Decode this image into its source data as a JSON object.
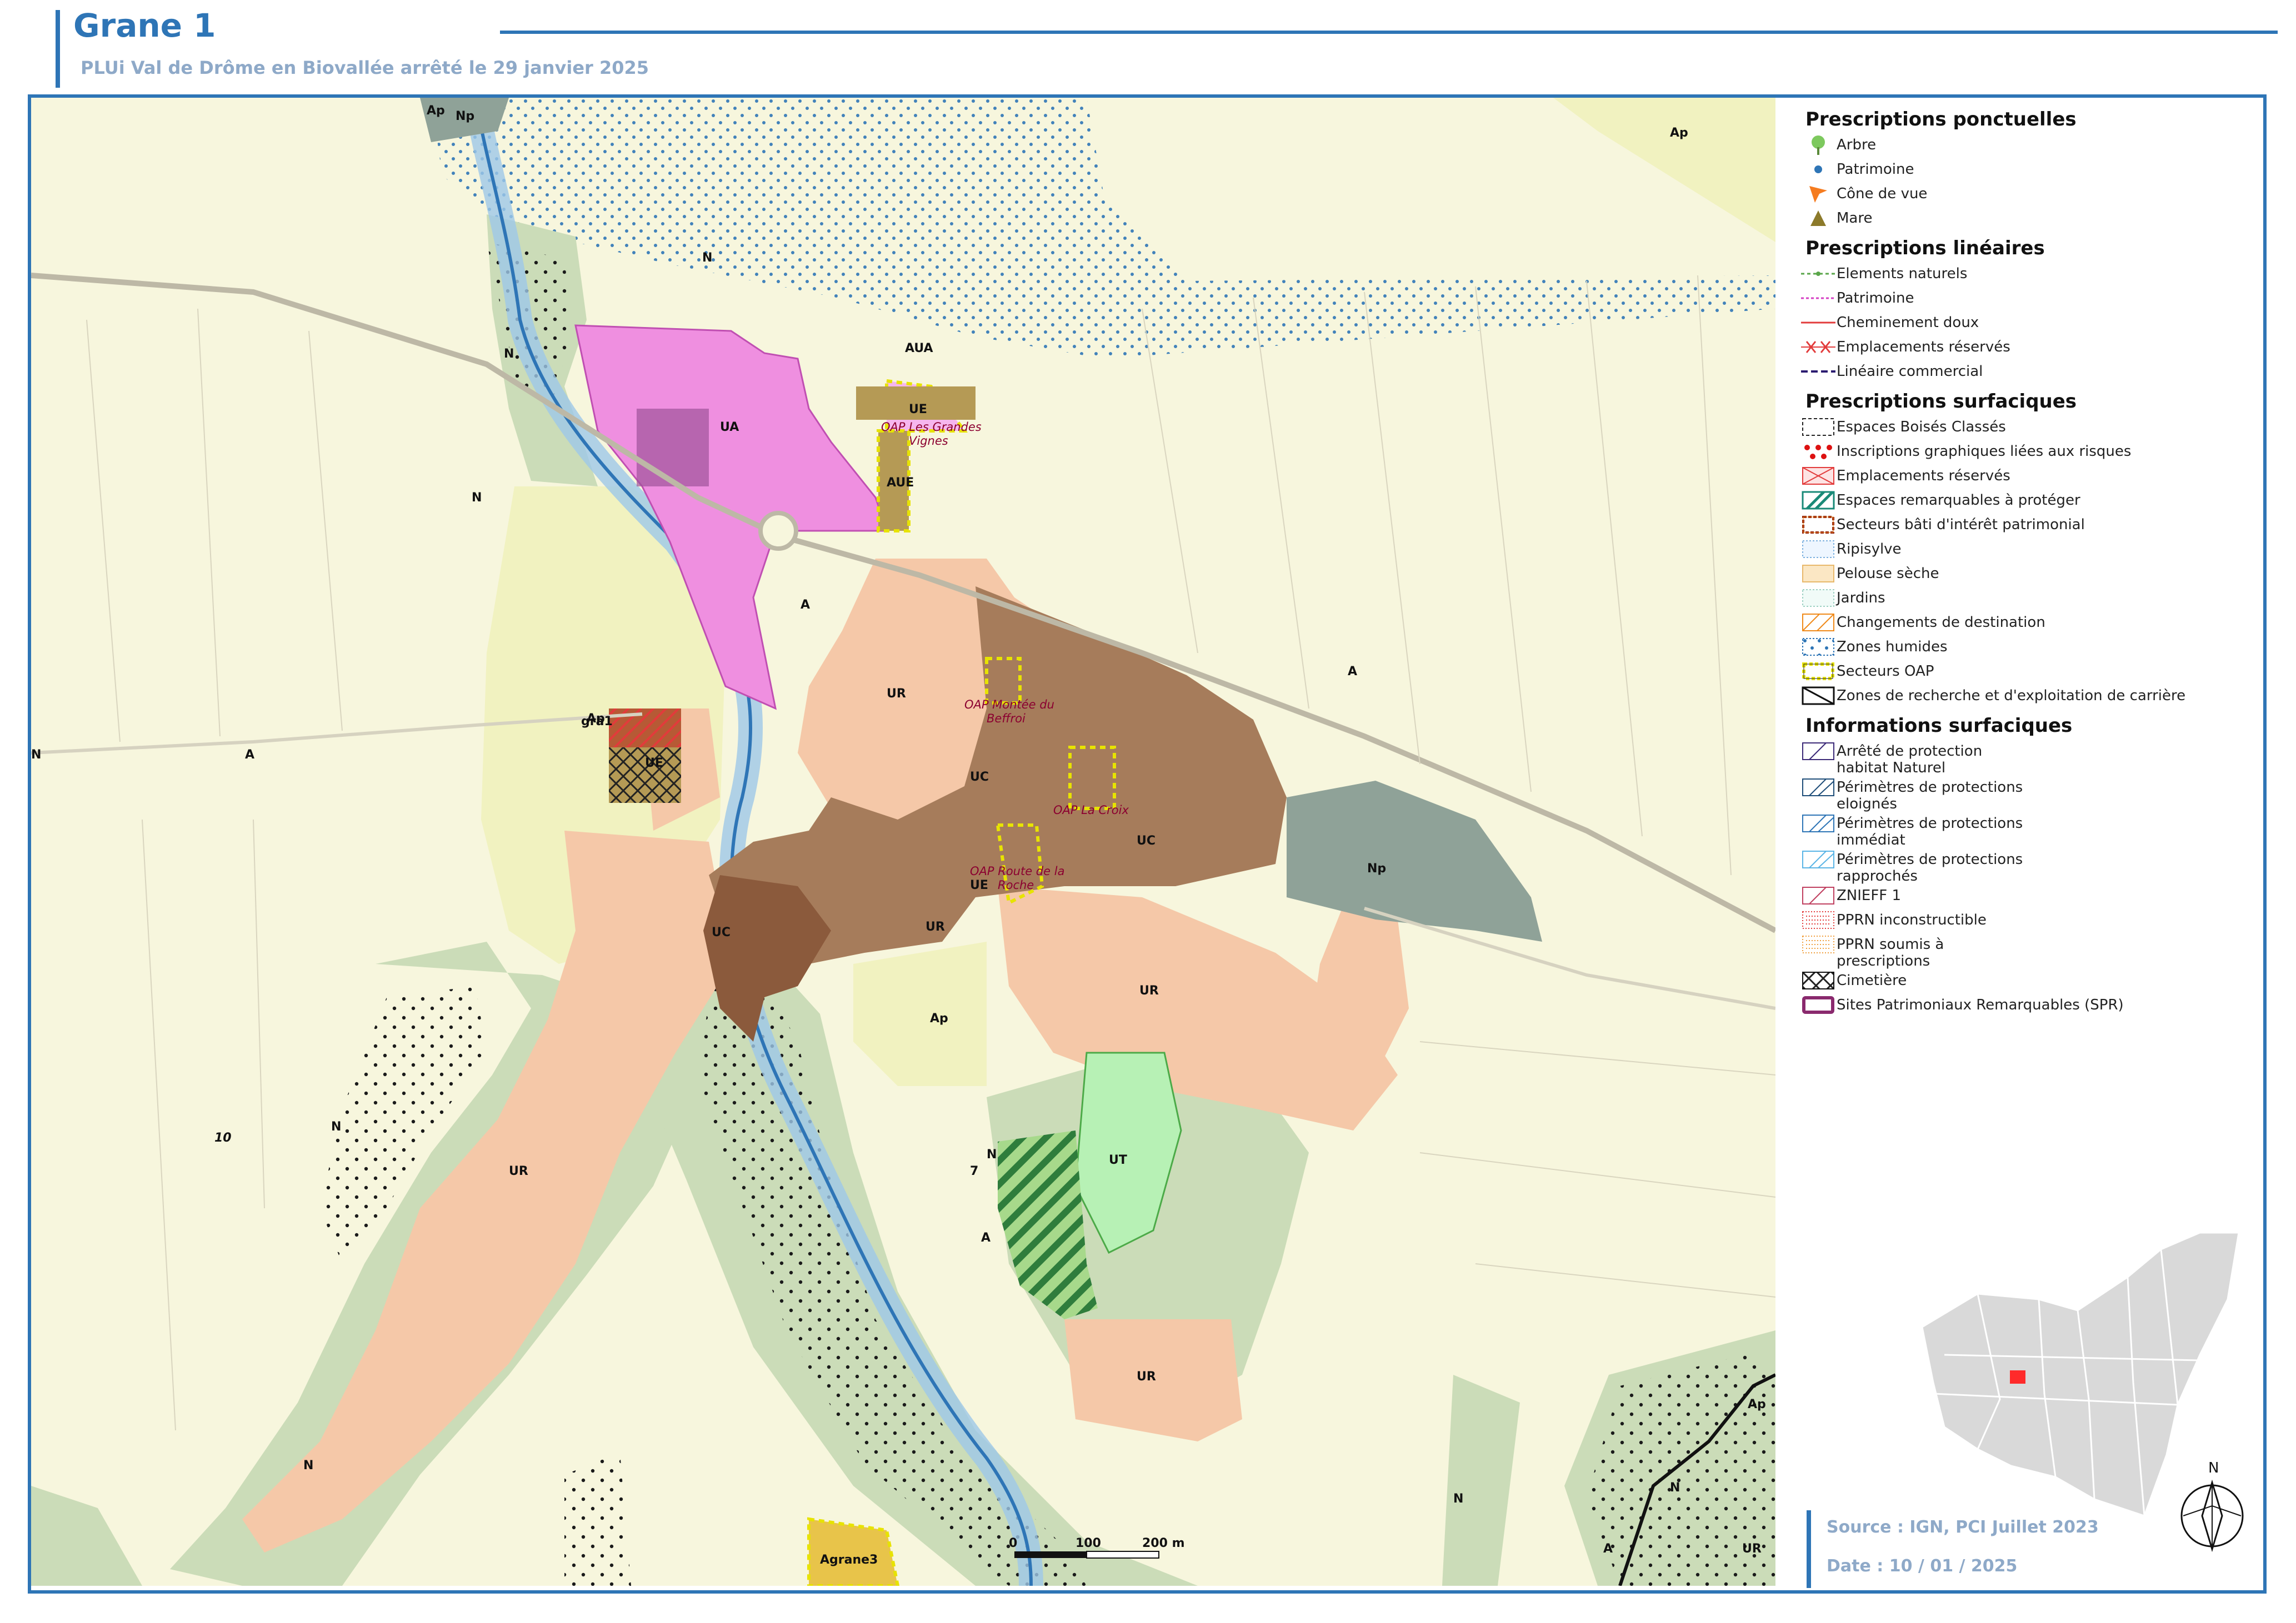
{
  "header": {
    "title": "Grane 1",
    "subtitle": "PLUi Val de Drôme en Biovallée arrêté le 29 janvier 2025"
  },
  "map": {
    "zones": [
      "Ap",
      "Np",
      "N",
      "AUA",
      "UE",
      "UA",
      "AUE",
      "A",
      "UR",
      "UC",
      "Ap",
      "UT",
      "Ap",
      "A",
      "N",
      "UR",
      "UR",
      "Np",
      "UC",
      "UR",
      "UE",
      "UE",
      "N",
      "N",
      "N",
      "A",
      "N",
      "N",
      "UR",
      "Ap",
      "N",
      "A",
      "N",
      "N",
      "N",
      "Ap",
      "UR"
    ],
    "oap": [
      "OAP Les Grandes Vignes",
      "OAP Montée du Beffroi",
      "OAP La Croix",
      "OAP Route de la Roche"
    ],
    "place_labels": [
      "Agrane3",
      "gra1"
    ],
    "numbers": [
      "10",
      "7"
    ],
    "scalebar": {
      "labels": [
        "0",
        "100",
        "200 m"
      ]
    },
    "colors": {
      "agricultural": "#f7f6dd",
      "protected_agri": "#f1f2c0",
      "natural": "#cbdcb8",
      "ur": "#f5c8a8",
      "uc": "#a67c5b",
      "ua": "#ef8fe0",
      "aue": "#b59a55",
      "np": "#8fa298",
      "ut": "#b7f1b5",
      "humid": "#2e75b6",
      "oap": "#f2e900"
    }
  },
  "legend": {
    "sections": [
      {
        "title": "Prescriptions ponctuelles",
        "items": [
          {
            "label": "Arbre",
            "icon": "tree-icon"
          },
          {
            "label": "Patrimoine",
            "icon": "dot-icon"
          },
          {
            "label": "Cône de vue",
            "icon": "view-cone-icon"
          },
          {
            "label": "Mare",
            "icon": "triangle-icon"
          }
        ]
      },
      {
        "title": "Prescriptions linéaires",
        "items": [
          {
            "label": "Elements naturels",
            "color": "#5aa64a"
          },
          {
            "label": "Patrimoine",
            "color": "#d43fc3"
          },
          {
            "label": "Cheminement doux",
            "color": "#e23b3b"
          },
          {
            "label": "Emplacements réservés",
            "color": "#e23b3b"
          },
          {
            "label": "Linéaire commercial",
            "color": "#2b1b70"
          }
        ]
      },
      {
        "title": "Prescriptions surfaciques",
        "items": [
          {
            "label": "Espaces Boisés Classés"
          },
          {
            "label": "Inscriptions graphiques liées aux risques"
          },
          {
            "label": "Emplacements réservés"
          },
          {
            "label": "Espaces remarquables à protéger"
          },
          {
            "label": "Secteurs bâti d'intérêt patrimonial"
          },
          {
            "label": "Ripisylve"
          },
          {
            "label": "Pelouse sèche"
          },
          {
            "label": "Jardins"
          },
          {
            "label": "Changements de destination"
          },
          {
            "label": "Zones humides"
          },
          {
            "label": "Secteurs OAP"
          },
          {
            "label": "Zones de recherche et d'exploitation de carrière"
          }
        ]
      },
      {
        "title": "Informations surfaciques",
        "items": [
          {
            "label": "Arrêté de protection habitat Naturel"
          },
          {
            "label": "Périmètres de protections eloignés"
          },
          {
            "label": "Périmètres de protections immédiat"
          },
          {
            "label": "Périmètres de protections rapprochés"
          },
          {
            "label": "ZNIEFF 1"
          },
          {
            "label": "PPRN inconstructible"
          },
          {
            "label": "PPRN soumis à prescriptions"
          },
          {
            "label": "Cimetière"
          },
          {
            "label": "Sites Patrimoniaux Remarquables (SPR)"
          }
        ]
      }
    ]
  },
  "footer": {
    "source": "Source : IGN, PCI Juillet 2023",
    "date": "Date : 10 / 01 / 2025",
    "north": "N"
  }
}
